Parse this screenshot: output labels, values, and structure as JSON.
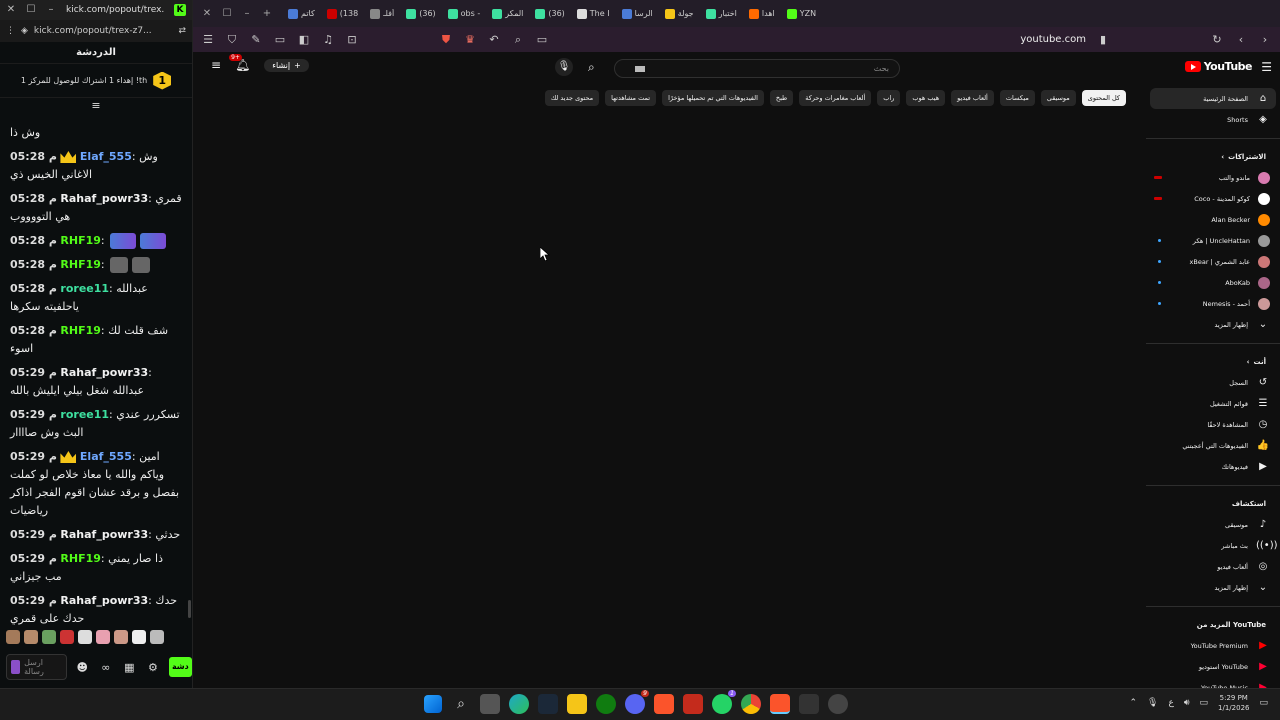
{
  "chat_window": {
    "title": "kick.com/popout/trex...",
    "url": "kick.com/popout/trex-z7...",
    "header": "الدردشة",
    "pinned_rank": "1",
    "pinned_text": "إهداء 1 اشتراك للوصول للمركز 1 !th",
    "filter_icon": "filter-icon",
    "messages": [
      {
        "time": "",
        "user": "",
        "text": "وش ذا",
        "color": "#eeeeee"
      },
      {
        "time": "05:28 م",
        "user": "Elaf_555",
        "text": "وش الاغاني الخيس ذي",
        "color": "#6fa8ff",
        "crown": true
      },
      {
        "time": "05:28 م",
        "user": "Rahaf_powr33",
        "text": "قمري هي التووووب",
        "color": "#f1f1f1"
      },
      {
        "time": "05:28 م",
        "user": "RHF19",
        "text": "",
        "color": "#53fc18",
        "emotes": 2
      },
      {
        "time": "05:28 م",
        "user": "RHF19",
        "text": "",
        "color": "#53fc18",
        "emotes_small": 2
      },
      {
        "time": "05:28 م",
        "user": "roree11",
        "text": "عبدالله ياحلفيته سكرها",
        "color": "#3ee0a0"
      },
      {
        "time": "05:28 م",
        "user": "RHF19",
        "text": "شف قلت لك اسوء",
        "color": "#53fc18"
      },
      {
        "time": "05:29 م",
        "user": "Rahaf_powr33",
        "text": "عبدالله شغل بيلي ايليش بالله",
        "color": "#f1f1f1"
      },
      {
        "time": "05:29 م",
        "user": "roree11",
        "text": "تسكررر عندي البث وش صاااار",
        "color": "#3ee0a0"
      },
      {
        "time": "05:29 م",
        "user": "Elaf_555",
        "text": "امين وياكم والله يا معاذ خلاص لو كملت بفصل و برقد عشان اقوم الفجر اذاكر رياضيات",
        "color": "#6fa8ff",
        "crown": true
      },
      {
        "time": "05:29 م",
        "user": "Rahaf_powr33",
        "text": "حدثي",
        "color": "#f1f1f1"
      },
      {
        "time": "05:29 م",
        "user": "RHF19",
        "text": "ذا صار يمني مب جيزاني",
        "color": "#53fc18"
      },
      {
        "time": "05:29 م",
        "user": "Rahaf_powr33",
        "text": "حدك حدك على قمري",
        "color": "#f1f1f1"
      }
    ],
    "input_placeholder": "ارسل رسالة",
    "send_label": "دشة"
  },
  "browser": {
    "tabs": [
      {
        "label": "كاتم",
        "color": "#4b7bd6"
      },
      {
        "label": "(138",
        "color": "#cc0000"
      },
      {
        "label": "أفلـ",
        "color": "#888888"
      },
      {
        "label": "(36)",
        "color": "#3ee0a0"
      },
      {
        "label": "obs -",
        "color": "#3ee0a0"
      },
      {
        "label": "المكر",
        "color": "#3ee0a0"
      },
      {
        "label": "(36)",
        "color": "#3ee0a0"
      },
      {
        "label": "The I",
        "color": "#dddddd"
      },
      {
        "label": "الرسا",
        "color": "#4b7bd6"
      },
      {
        "label": "جولة",
        "color": "#f5c518"
      },
      {
        "label": "اختبار",
        "color": "#3ee0a0"
      },
      {
        "label": "اهدا",
        "color": "#ff6a00"
      },
      {
        "label": "YZN",
        "color": "#53fc18"
      }
    ],
    "address": "youtube.com"
  },
  "youtube": {
    "logo_text": "YouTube",
    "create_label": "إنشاء",
    "notif_count": "9+",
    "search_placeholder": "بحث",
    "chips": [
      {
        "label": "كل المحتوى",
        "active": true
      },
      {
        "label": "موسيقى"
      },
      {
        "label": "ميكسات"
      },
      {
        "label": "ألعاب فيديو"
      },
      {
        "label": "هيب هوب"
      },
      {
        "label": "راب"
      },
      {
        "label": "ألعاب مغامرات وحركة"
      },
      {
        "label": "طبخ"
      },
      {
        "label": "الفيديوهات التي تم تحميلها مؤخرًا"
      },
      {
        "label": "تمت مشاهدتها"
      },
      {
        "label": "محتوى جديد لك"
      }
    ],
    "guide": {
      "main": [
        {
          "label": "الصفحة الرئيسية",
          "icon": "home-icon",
          "glyph": "⌂",
          "active": true
        },
        {
          "label": "Shorts",
          "icon": "shorts-icon",
          "glyph": "◈"
        }
      ],
      "subs_header": "الاشتراكات",
      "subs": [
        {
          "label": "ماندو والتب",
          "live": true,
          "color": "#d97bb0"
        },
        {
          "label": "Coco - كوكو المدينة",
          "live": true,
          "color": "#ffffff"
        },
        {
          "label": "Alan Becker",
          "color": "#ff8a00"
        },
        {
          "label": "هكر | UncleHattan",
          "dot": true,
          "color": "#999999"
        },
        {
          "label": "xBear | عابد الشمري",
          "dot": true,
          "color": "#cc7777"
        },
        {
          "label": "AboKab",
          "dot": true,
          "color": "#aa6688"
        },
        {
          "label": "Nemesis - أحمد",
          "dot": true,
          "color": "#cc9999"
        }
      ],
      "subs_more": "إظهار المزيد",
      "you_header": "أنت",
      "you": [
        {
          "label": "السجل",
          "icon": "history-icon",
          "glyph": "↺"
        },
        {
          "label": "قوائم التشغيل",
          "icon": "playlists-icon",
          "glyph": "☰"
        },
        {
          "label": "المشاهدة لاحقًا",
          "icon": "clock-icon",
          "glyph": "◷"
        },
        {
          "label": "الفيديوهات التي أعجبتني",
          "icon": "like-icon",
          "glyph": "👍"
        },
        {
          "label": "فيديوهاتك",
          "icon": "your-videos-icon",
          "glyph": "▶"
        }
      ],
      "explore_header": "استكشاف",
      "explore": [
        {
          "label": "موسيقى",
          "icon": "music-icon",
          "glyph": "♪"
        },
        {
          "label": "بث مباشر",
          "icon": "live-icon",
          "glyph": "((•))"
        },
        {
          "label": "ألعاب فيديو",
          "icon": "gaming-icon",
          "glyph": "◎"
        }
      ],
      "explore_more": "إظهار المزيد",
      "more_header": "المزيد من YouTube",
      "more": [
        {
          "label": "YouTube Premium",
          "color": "#ff0000"
        },
        {
          "label": "استوديو YouTube",
          "color": "#ff0033"
        },
        {
          "label": "YouTube Music",
          "color": "#ff0033"
        }
      ]
    }
  },
  "taskbar": {
    "clock_time": "5:29 PM",
    "clock_date": "1/1/2026",
    "lang": "ع"
  }
}
